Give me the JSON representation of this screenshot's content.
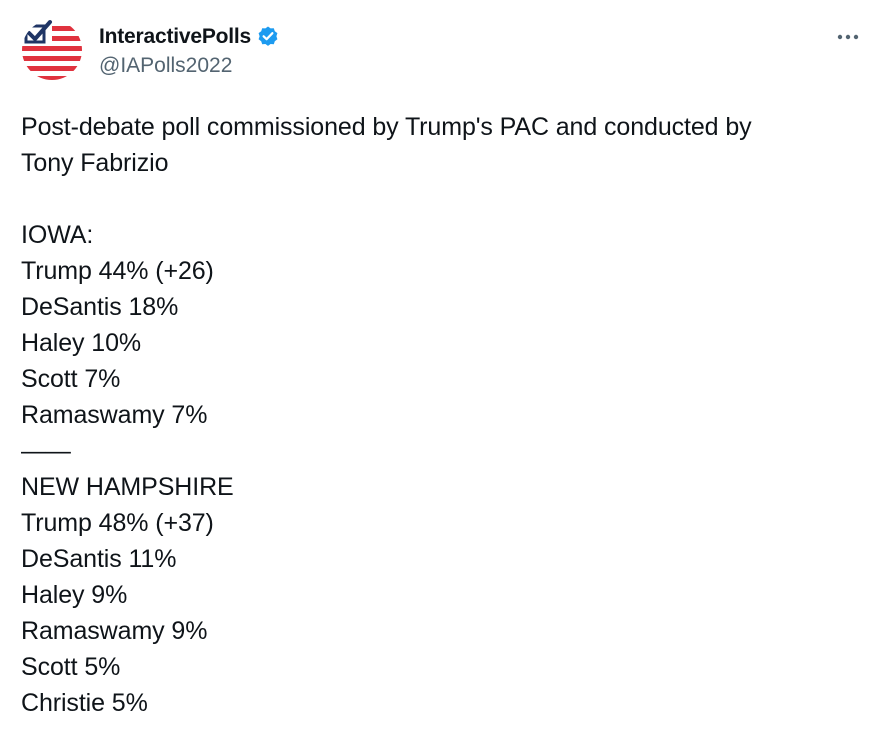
{
  "author": {
    "display_name": "InteractivePolls",
    "handle": "@IAPolls2022",
    "verified_icon": "verified-badge-icon",
    "avatar_icon": "us-flag-checkmark-logo"
  },
  "menu": {
    "more_icon": "more-horizontal-icon"
  },
  "colors": {
    "verified_blue": "#1d9bf0",
    "flag_red": "#e0323e",
    "flag_navy": "#1f3565",
    "text_primary": "#0f1419",
    "text_secondary": "#536471"
  },
  "tweet": {
    "intro_line1": "Post-debate poll commissioned by Trump's PAC and conducted by",
    "intro_line2": "Tony Fabrizio",
    "iowa": {
      "header": "IOWA:",
      "results": [
        "Trump 44% (+26)",
        "DeSantis 18%",
        "Haley 10%",
        "Scott 7%",
        "Ramaswamy 7%"
      ]
    },
    "separator": "——",
    "new_hampshire": {
      "header": "NEW HAMPSHIRE",
      "results": [
        "Trump 48% (+37)",
        "DeSantis 11%",
        "Haley 9%",
        "Ramaswamy 9%",
        "Scott 5%",
        "Christie 5%"
      ]
    }
  }
}
